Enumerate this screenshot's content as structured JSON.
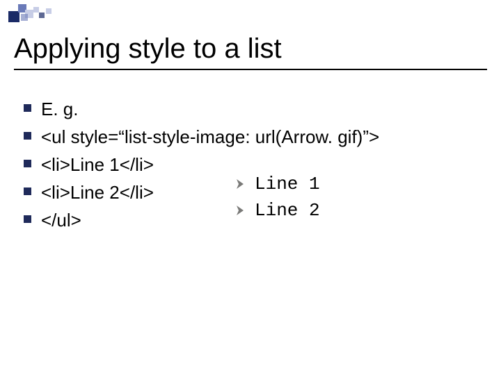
{
  "title": "Applying style to a list",
  "bullets": [
    "E. g.",
    "<ul style=“list-style-image: url(Arrow. gif)”>",
    "<li>Line 1</li>",
    "<li>Line 2</li>",
    "</ul>"
  ],
  "example": {
    "line1": "Line 1",
    "line2": "Line 2"
  },
  "colors": {
    "bullet": "#1f2a5a",
    "arrow": "#7a7a78",
    "deco_dark": "#1a2a66",
    "deco_mid": "#6a7ab8",
    "deco_light": "#c7cde6"
  }
}
